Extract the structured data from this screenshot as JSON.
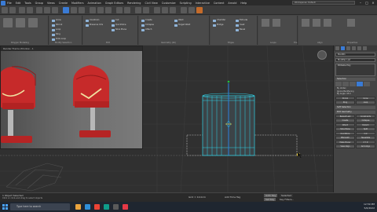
{
  "menubar": {
    "items": [
      "File",
      "Edit",
      "Tools",
      "Group",
      "Views",
      "Create",
      "Modifiers",
      "Animation",
      "Graph Editors",
      "Rendering",
      "Civil View",
      "Customize",
      "Scripting",
      "Interactive",
      "Content",
      "Arnold",
      "Help"
    ],
    "workspace": "Workspaces: Default"
  },
  "window_controls": [
    "–",
    "□",
    "×"
  ],
  "ribbon": {
    "modeling_buttons": [
      "Constrain",
      "Preserve UVs",
      "Create",
      "Collapse",
      "Attach",
      "Cut",
      "QuickSlice",
      "Slice Plane",
      "Weld",
      "Target Weld",
      "Chamfer",
      "Bridge",
      "Extrude",
      "Inset",
      "Bevel",
      "Loop",
      "Ring",
      "Dots Loop",
      "Grow",
      "Shrink"
    ],
    "labels": [
      "Polygon Modeling",
      "Modify Selection",
      "Edit",
      "Geometry (All)",
      "Edges",
      "Loops",
      "Tris",
      "Align",
      "Properties"
    ]
  },
  "viewport": {
    "label": "[+] [Perspective] [Standard] [Default Shading]"
  },
  "preview_window": {
    "title": "Render Frame Window - 1"
  },
  "right_panel": {
    "object_name": "Box001",
    "modifier_list": "Modifier List",
    "stack_item": "Editable Poly",
    "rollouts": [
      "Selection",
      "Soft Selection",
      "Edit Geometry"
    ],
    "buttons": [
      "Grow",
      "Shrink",
      "Ring",
      "Loop",
      "Repeat Last",
      "Constraints",
      "Create",
      "Collapse",
      "Attach",
      "Detach",
      "Slice Plane",
      "Split",
      "QuickSlice",
      "Cut",
      "MSmooth",
      "Tessellate",
      "Make Planar",
      "X Y Z",
      "View Align",
      "Grid Align"
    ],
    "selection_options": [
      "By Vertex",
      "Ignore Backfacing",
      "By Angle: 45.0",
      "Shrink",
      "Grow",
      "Ring",
      "Loop"
    ]
  },
  "status": {
    "selection": "1 Object Selected",
    "prompt": "Click or click-and-drag to select objects",
    "grid": "Grid = 10.0cm",
    "add_time_tag": "Add Time Tag",
    "autokey": "Auto Key",
    "selected": "Selected",
    "setkey": "Set Key",
    "key_filters": "Key Filters..."
  },
  "taskbar": {
    "search_placeholder": "Type here to search",
    "time": "12:59 PM",
    "date": "5/6/2022"
  },
  "colors": {
    "accent": "#3a7bd5",
    "selection_cyan": "#2fd3e8",
    "gizmo_yellow": "#f2d23c",
    "gizmo_green": "#21c23b",
    "mailbox_red": "#c62a2a"
  }
}
